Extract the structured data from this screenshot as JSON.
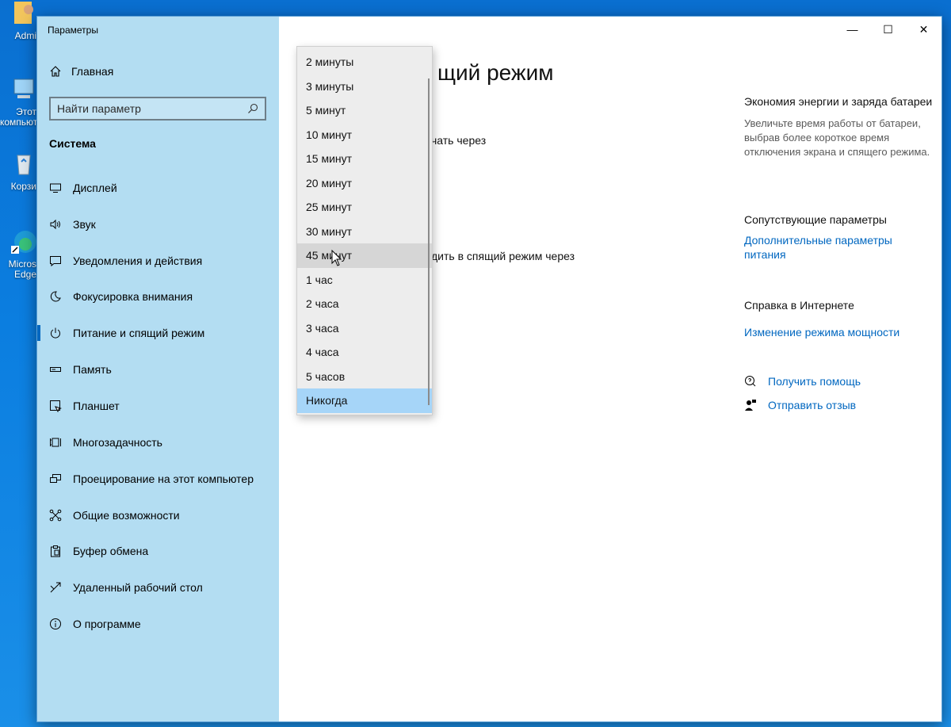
{
  "desktop": {
    "icons": [
      {
        "label": "Admi"
      },
      {
        "label": "Этот компьютер"
      },
      {
        "label": "Корзи"
      },
      {
        "label": "Micros Edge"
      }
    ]
  },
  "window": {
    "title": "Параметры",
    "caption": {
      "minimize": "—",
      "maximize": "☐",
      "close": "✕"
    }
  },
  "sidebar": {
    "home_label": "Главная",
    "search_placeholder": "Найти параметр",
    "section_title": "Система",
    "items": [
      {
        "label": "Дисплей",
        "icon": "display-icon"
      },
      {
        "label": "Звук",
        "icon": "speaker-icon"
      },
      {
        "label": "Уведомления и действия",
        "icon": "notification-icon"
      },
      {
        "label": "Фокусировка внимания",
        "icon": "moon-icon"
      },
      {
        "label": "Питание и спящий режим",
        "icon": "power-icon",
        "active": true
      },
      {
        "label": "Память",
        "icon": "storage-icon"
      },
      {
        "label": "Планшет",
        "icon": "tablet-icon"
      },
      {
        "label": "Многозадачность",
        "icon": "multitasking-icon"
      },
      {
        "label": "Проецирование на этот компьютер",
        "icon": "projection-icon"
      },
      {
        "label": "Общие возможности",
        "icon": "shared-experiences-icon"
      },
      {
        "label": "Буфер обмена",
        "icon": "clipboard-icon"
      },
      {
        "label": "Удаленный рабочий стол",
        "icon": "remote-desktop-icon"
      },
      {
        "label": "О программе",
        "icon": "info-icon"
      }
    ]
  },
  "main": {
    "page_title_visible": "щий режим",
    "screen_label_visible": "чать через",
    "sleep_label_visible": "дить в спящий режим через"
  },
  "dropdown": {
    "options": [
      "2 минуты",
      "3 минуты",
      "5 минут",
      "10 минут",
      "15 минут",
      "20 минут",
      "25 минут",
      "30 минут",
      "45 минут",
      "1 час",
      "2 часа",
      "3 часа",
      "4 часа",
      "5 часов",
      "Никогда"
    ],
    "hover_option": "45 минут",
    "selected_option": "Никогда"
  },
  "right_panel": {
    "energy_heading": "Экономия энергии и заряда батареи",
    "energy_text": "Увеличьте время работы от батареи, выбрав более короткое время отключения экрана и спящего режима.",
    "related_heading": "Сопутствующие параметры",
    "related_link": "Дополнительные параметры питания",
    "web_help_heading": "Справка в Интернете",
    "web_help_link": "Изменение режима мощности",
    "get_help": "Получить помощь",
    "feedback": "Отправить отзыв"
  },
  "colors": {
    "sidebar_bg": "#b3ddf2",
    "accent": "#0067c0",
    "selected_option_bg": "#a6d5f8",
    "desktop_bg": "#0b7ee0"
  }
}
